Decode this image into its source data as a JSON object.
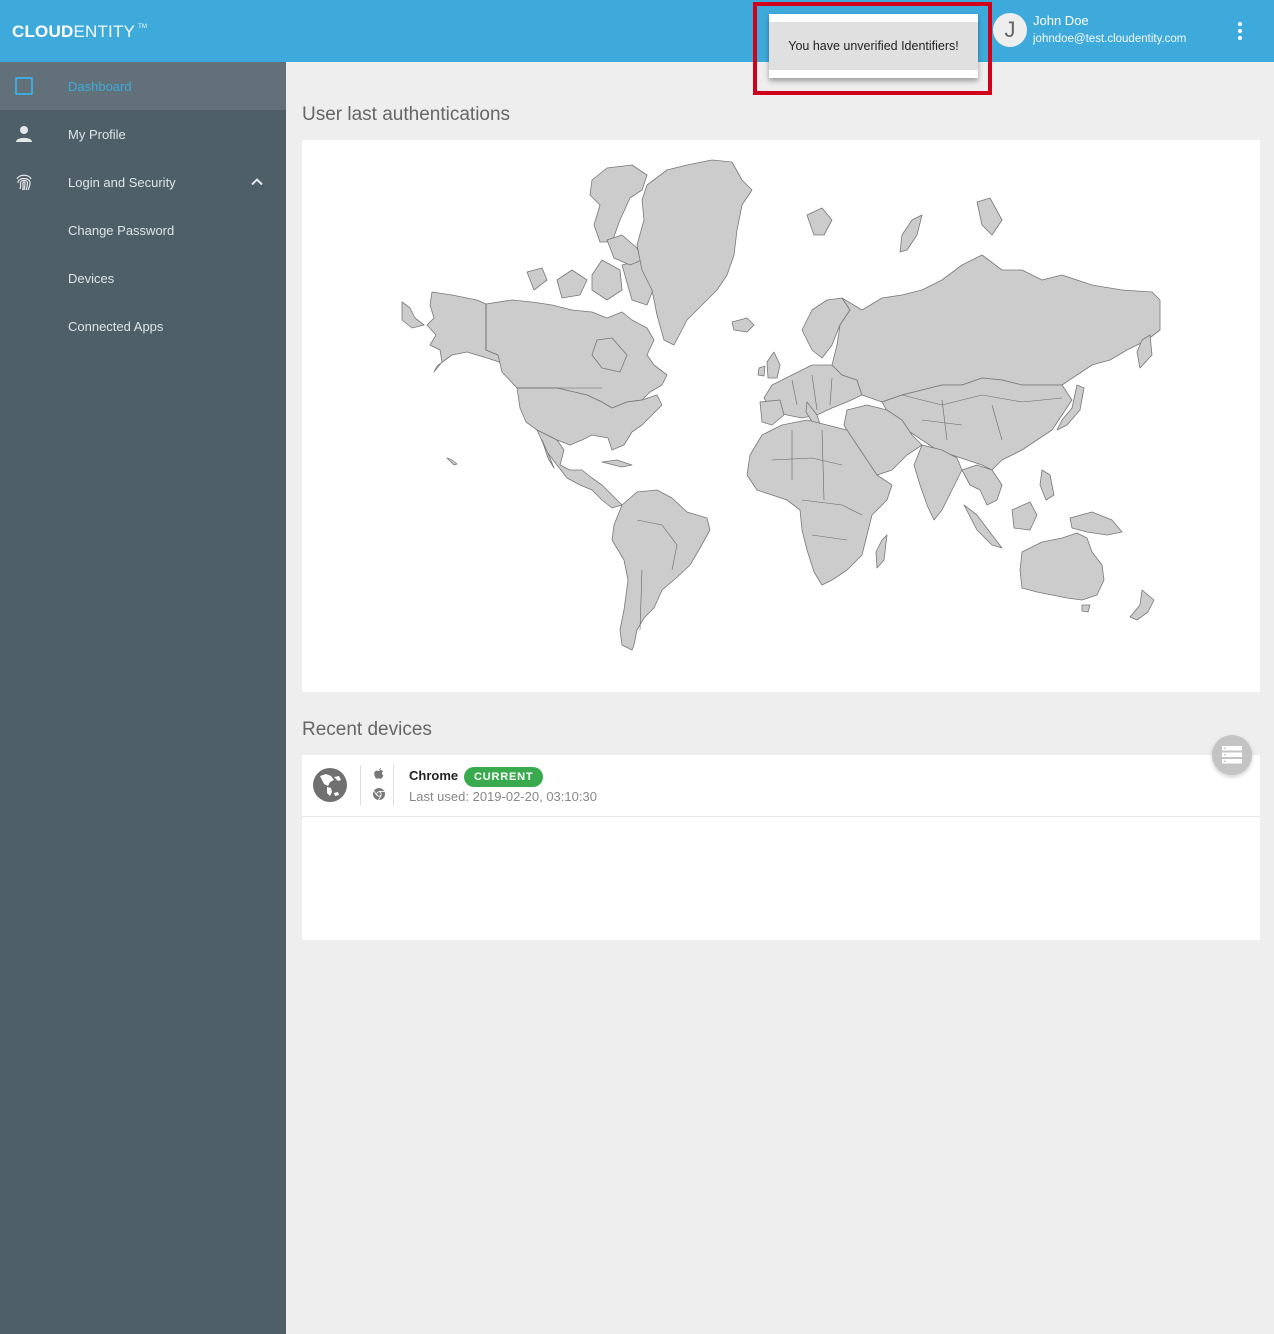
{
  "app": {
    "brand_bold": "CLOUD",
    "brand_light": "ENTITY",
    "brand_tm": "TM"
  },
  "header": {
    "notification": "You have unverified Identifiers!",
    "user": {
      "initial": "J",
      "name": "John Doe",
      "email": "johndoe@test.cloudentity.com"
    },
    "menu_icon": "more-vert-icon"
  },
  "sidebar": {
    "items": [
      {
        "label": "Dashboard",
        "icon": "dashboard-square-icon",
        "active": true
      },
      {
        "label": "My Profile",
        "icon": "person-icon",
        "active": false
      },
      {
        "label": "Login and Security",
        "icon": "fingerprint-icon",
        "active": false,
        "expanded": true
      },
      {
        "label": "Change Password",
        "icon": "",
        "active": false
      },
      {
        "label": "Devices",
        "icon": "",
        "active": false
      },
      {
        "label": "Connected Apps",
        "icon": "",
        "active": false
      }
    ]
  },
  "main": {
    "map_section_title": "User last authentications",
    "devices_section_title": "Recent devices",
    "devices": [
      {
        "name": "Chrome",
        "badge": "CURRENT",
        "last_used": "Last used: 2019-02-20, 03:10:30",
        "os_icon": "apple-icon",
        "browser_icon": "chrome-icon",
        "location_icon": "globe-icon"
      }
    ],
    "list_toggle_icon": "list-view-icon"
  },
  "colors": {
    "header": "#3eaadc",
    "sidebar": "#4f5f68",
    "sidebar_active": "#627179",
    "accent": "#3eaadc",
    "highlight_border": "#d0021b",
    "badge_current": "#3aaa4f",
    "map_land": "#cccccc",
    "map_border": "#777777"
  }
}
